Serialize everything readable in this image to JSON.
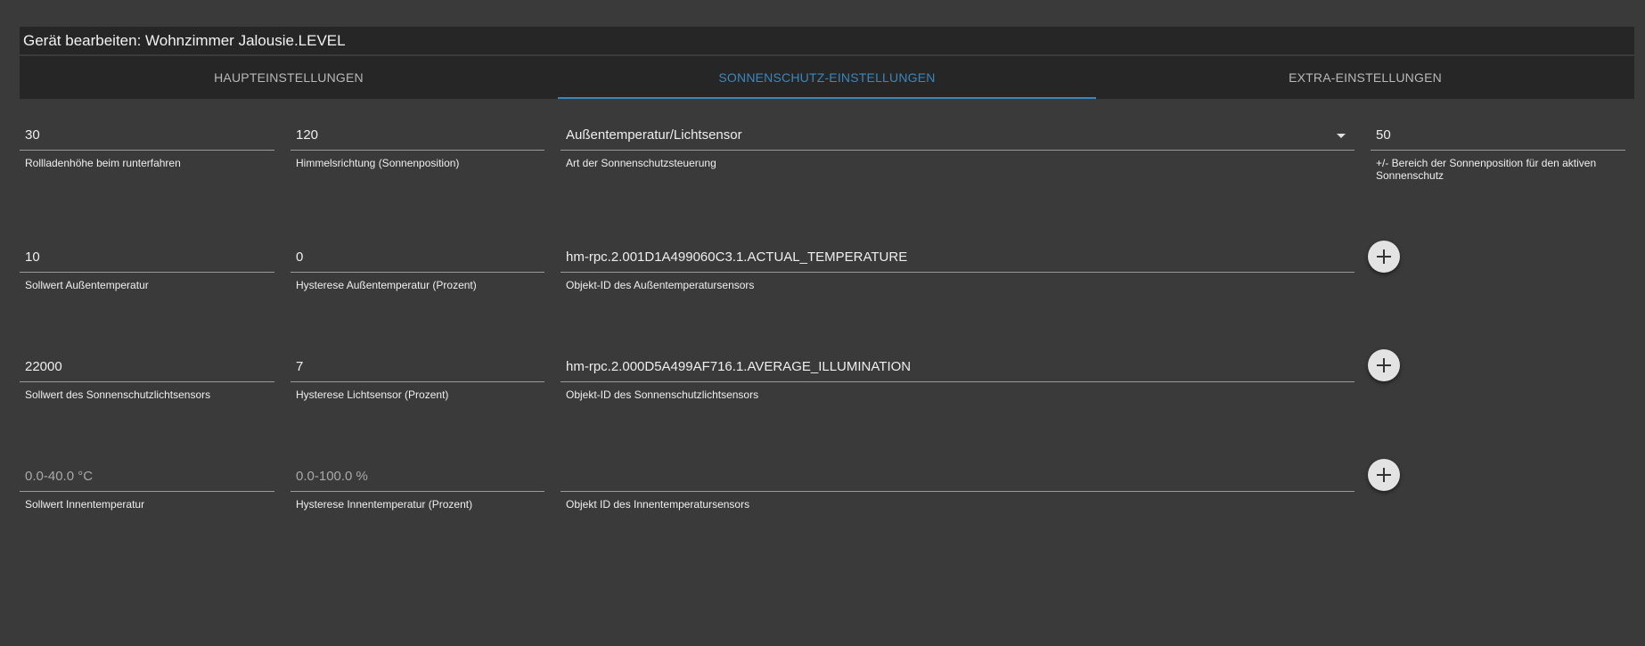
{
  "dialog": {
    "title": "Gerät bearbeiten: Wohnzimmer Jalousie.LEVEL"
  },
  "tabs": [
    {
      "label": "HAUPTEINSTELLUNGEN",
      "active": false
    },
    {
      "label": "SONNENSCHUTZ-EINSTELLUNGEN",
      "active": true
    },
    {
      "label": "EXTRA-EINSTELLUNGEN",
      "active": false
    }
  ],
  "row1": {
    "shutter_height": {
      "value": "30",
      "label": "Rollladenhöhe beim runterfahren"
    },
    "direction": {
      "value": "120",
      "label": "Himmelsrichtung (Sonnenposition)"
    },
    "control_type": {
      "value": "Außentemperatur/Lichtsensor",
      "label": "Art der Sonnenschutzsteuerung"
    },
    "sun_range": {
      "value": "50",
      "label": "+/- Bereich der Sonnenposition für den aktiven Sonnenschutz"
    }
  },
  "row2": {
    "outside_temp_setpoint": {
      "value": "10",
      "label": "Sollwert Außentemperatur"
    },
    "outside_temp_hysteresis": {
      "value": "0",
      "label": "Hysterese Außentemperatur (Prozent)"
    },
    "outside_temp_sensor": {
      "value": "hm-rpc.2.001D1A499060C3.1.ACTUAL_TEMPERATURE",
      "label": "Objekt-ID des Außentemperatursensors"
    }
  },
  "row3": {
    "light_setpoint": {
      "value": "22000",
      "label": "Sollwert des Sonnenschutzlichtsensors"
    },
    "light_hysteresis": {
      "value": "7",
      "label": "Hysterese Lichtsensor (Prozent)"
    },
    "light_sensor": {
      "value": "hm-rpc.2.000D5A499AF716.1.AVERAGE_ILLUMINATION",
      "label": "Objekt-ID des Sonnenschutzlichtsensors"
    }
  },
  "row4": {
    "inside_temp_setpoint": {
      "placeholder": "0.0-40.0 °C",
      "label": "Sollwert Innentemperatur"
    },
    "inside_temp_hysteresis": {
      "placeholder": "0.0-100.0 %",
      "label": "Hysterese Innentemperatur (Prozent)"
    },
    "inside_temp_sensor": {
      "value": "",
      "label": "Objekt ID des Innentemperatursensors"
    }
  },
  "icons": {
    "add": "plus-icon",
    "dropdown": "chevron-down-icon"
  }
}
